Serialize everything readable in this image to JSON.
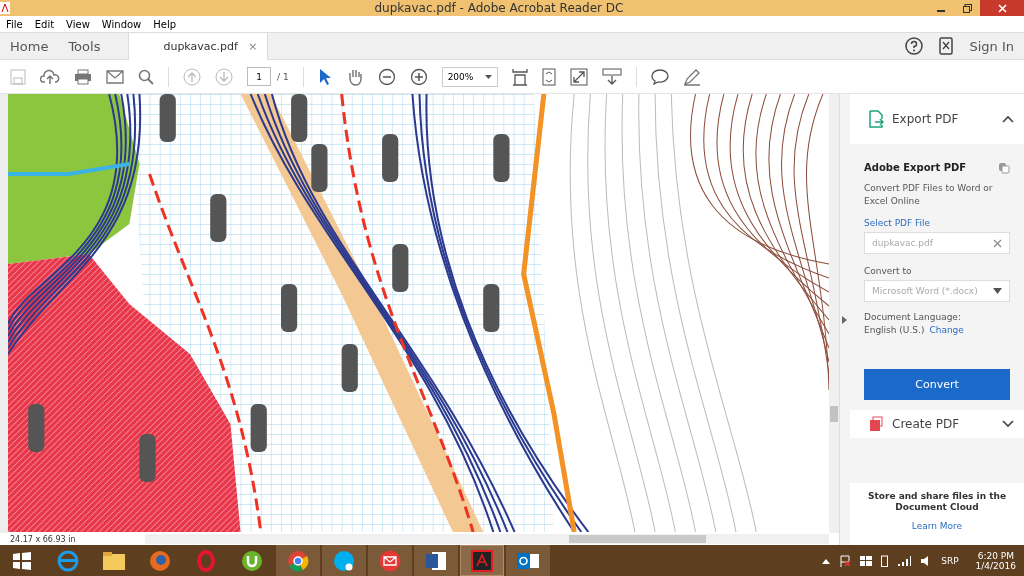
{
  "window": {
    "title": "dupkavac.pdf - Adobe Acrobat Reader DC"
  },
  "menu": [
    "File",
    "Edit",
    "View",
    "Window",
    "Help"
  ],
  "nav_tabs": [
    "Home",
    "Tools"
  ],
  "doc_tab": {
    "label": "dupkavac.pdf",
    "close": "×"
  },
  "sign_in": "Sign In",
  "toolbar": {
    "page": "1",
    "page_total": "/ 1",
    "zoom": "200%",
    "tools": [
      {
        "kind": "select",
        "selected": true
      },
      {
        "kind": "hand",
        "selected": false
      }
    ]
  },
  "panel": {
    "export": {
      "title": "Export PDF",
      "expanded": true
    },
    "heading": "Adobe Export PDF",
    "description": "Convert PDF Files to Word or Excel Online",
    "select_link": "Select PDF File",
    "file": "dupkavac.pdf",
    "convert_label": "Convert to",
    "format": "Microsoft Word (*.docx)",
    "language_label": "Document Language:",
    "language": "English (U.S.)",
    "change": "Change",
    "button": "Convert",
    "create": {
      "title": "Create PDF",
      "expanded": false
    },
    "cloud_text": "Store and share files in the Document Cloud",
    "learn_more": "Learn More"
  },
  "status_bar": {
    "size": "24.17 x 66.93 in"
  },
  "taskbar": {
    "apps": [
      {
        "kind": "ie",
        "open": false,
        "selected": false
      },
      {
        "kind": "folder",
        "open": false,
        "selected": false
      },
      {
        "kind": "firefox",
        "open": false,
        "selected": false
      },
      {
        "kind": "opera",
        "open": false,
        "selected": false
      },
      {
        "kind": "utorrent",
        "open": false,
        "selected": false
      },
      {
        "kind": "chrome",
        "open": true,
        "selected": false
      },
      {
        "kind": "skype",
        "open": true,
        "selected": false
      },
      {
        "kind": "mail",
        "open": true,
        "selected": false
      },
      {
        "kind": "word",
        "open": true,
        "selected": false
      },
      {
        "kind": "acrobat",
        "open": true,
        "selected": true
      },
      {
        "kind": "outlook",
        "open": true,
        "selected": false
      }
    ],
    "language": "SRP",
    "time": "6:20 PM",
    "date": "1/4/2016"
  }
}
